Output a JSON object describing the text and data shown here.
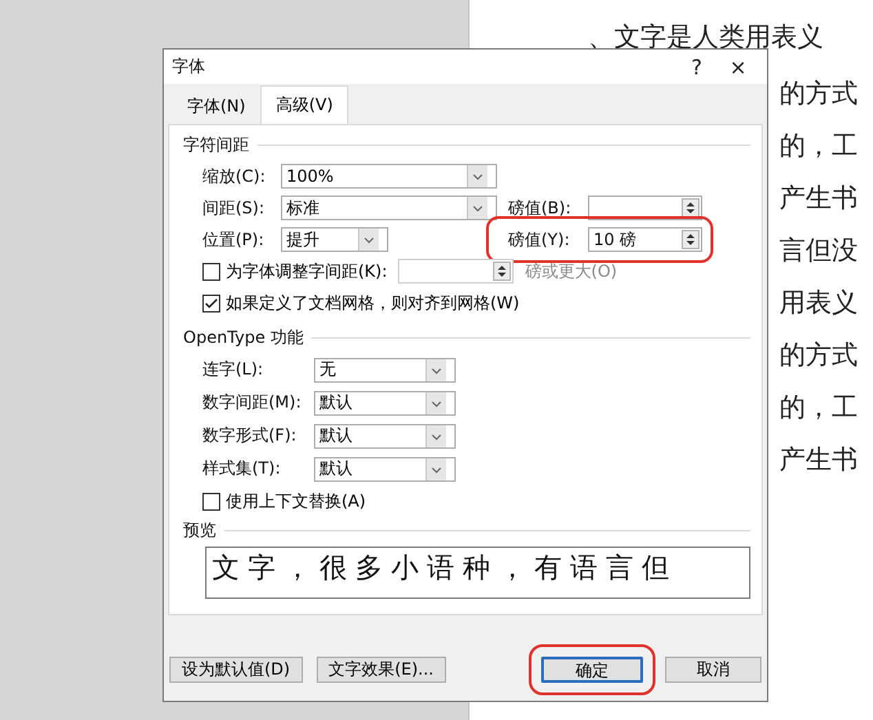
{
  "document": {
    "first_line": "、文字是人类用表义",
    "lines": [
      "的方式",
      "的，工",
      "产生书",
      "言但没",
      "用表义",
      "的方式",
      "的，工",
      "产生书"
    ]
  },
  "dialog": {
    "title": "字体",
    "help": "?",
    "close": "×",
    "tabs": [
      {
        "label": "字体(N)",
        "selected": false
      },
      {
        "label": "高级(V)",
        "selected": true
      }
    ],
    "spacing_section": {
      "title": "字符间距",
      "scale": {
        "label": "缩放(C):",
        "value": "100%"
      },
      "spacing": {
        "label": "间距(S):",
        "value": "标准"
      },
      "spacing_by": {
        "label": "磅值(B):"
      },
      "position": {
        "label": "位置(P):",
        "value": "提升"
      },
      "position_by": {
        "label": "磅值(Y):",
        "value": "10 磅",
        "highlighted": true
      },
      "kerning": {
        "label": "为字体调整字间距(K):",
        "checked": false,
        "suffix": "磅或更大(O)"
      },
      "snap_grid": {
        "label": "如果定义了文档网格，则对齐到网格(W)",
        "checked": true
      }
    },
    "opentype_section": {
      "title": "OpenType 功能",
      "fields": [
        {
          "label": "连字(L):",
          "value": "无"
        },
        {
          "label": "数字间距(M):",
          "value": "默认"
        },
        {
          "label": "数字形式(F):",
          "value": "默认"
        },
        {
          "label": "样式集(T):",
          "value": "默认"
        }
      ],
      "contextual": {
        "label": "使用上下文替换(A)",
        "checked": false
      }
    },
    "preview": {
      "title": "预览",
      "sample": "文字，很多小语种，有语言但"
    },
    "buttons": [
      {
        "label": "设为默认值(D)",
        "kind": "option",
        "highlighted": false
      },
      {
        "label": "文字效果(E)...",
        "kind": "option",
        "highlighted": false
      },
      {
        "label": "确定",
        "kind": "default",
        "highlighted": true
      },
      {
        "label": "取消",
        "kind": "cancel",
        "highlighted": false
      }
    ]
  }
}
